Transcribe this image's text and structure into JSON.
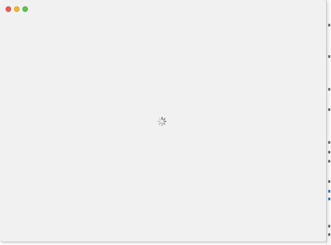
{
  "window": {
    "controls": [
      "close",
      "minimize",
      "zoom"
    ],
    "colors": {
      "close": "#ee5b56",
      "minimize": "#f3b634",
      "zoom": "#5fc54a",
      "background": "#f1f1f1"
    }
  },
  "content": {
    "state": "loading",
    "indicator_icon": "spinner-icon"
  }
}
